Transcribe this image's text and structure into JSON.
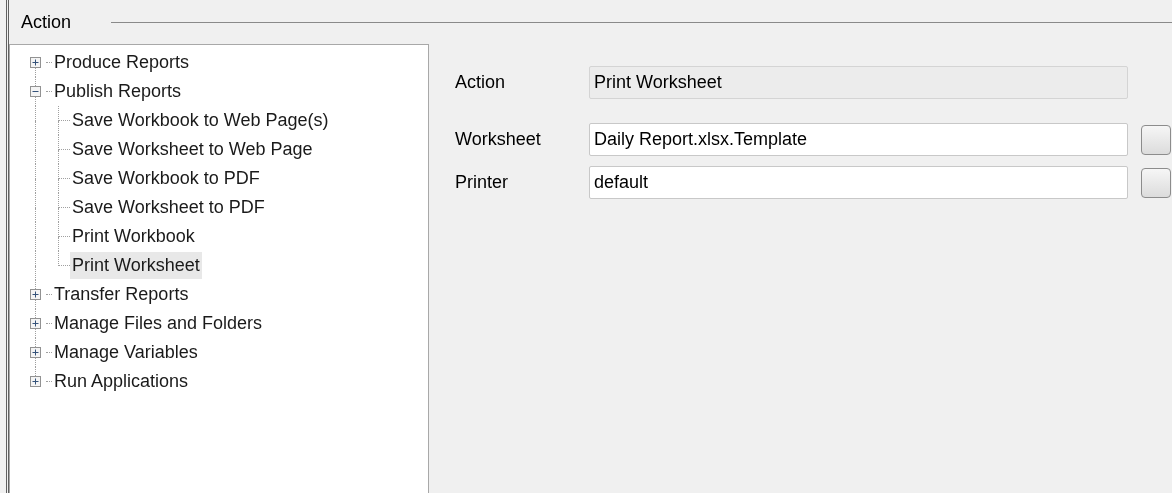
{
  "group": {
    "title": "Action"
  },
  "tree": [
    {
      "label": "Produce Reports",
      "expanded": false,
      "selected": false
    },
    {
      "label": "Publish Reports",
      "expanded": true,
      "selected": false,
      "children": [
        {
          "label": "Save Workbook to Web Page(s)",
          "selected": false
        },
        {
          "label": "Save Worksheet to Web Page",
          "selected": false
        },
        {
          "label": "Save Workbook to PDF",
          "selected": false
        },
        {
          "label": "Save Worksheet to PDF",
          "selected": false
        },
        {
          "label": "Print Workbook",
          "selected": false
        },
        {
          "label": "Print Worksheet",
          "selected": true
        }
      ]
    },
    {
      "label": "Transfer Reports",
      "expanded": false,
      "selected": false
    },
    {
      "label": "Manage Files and Folders",
      "expanded": false,
      "selected": false
    },
    {
      "label": "Manage Variables",
      "expanded": false,
      "selected": false
    },
    {
      "label": "Run Applications",
      "expanded": false,
      "selected": false
    }
  ],
  "fields": [
    {
      "label": "Action",
      "value": "Print Worksheet",
      "readonly": true,
      "browse": false
    },
    {
      "label": "Worksheet",
      "value": "Daily Report.xlsx.Template",
      "readonly": false,
      "browse": true
    },
    {
      "label": "Printer",
      "value": "default",
      "readonly": false,
      "browse": true
    }
  ]
}
